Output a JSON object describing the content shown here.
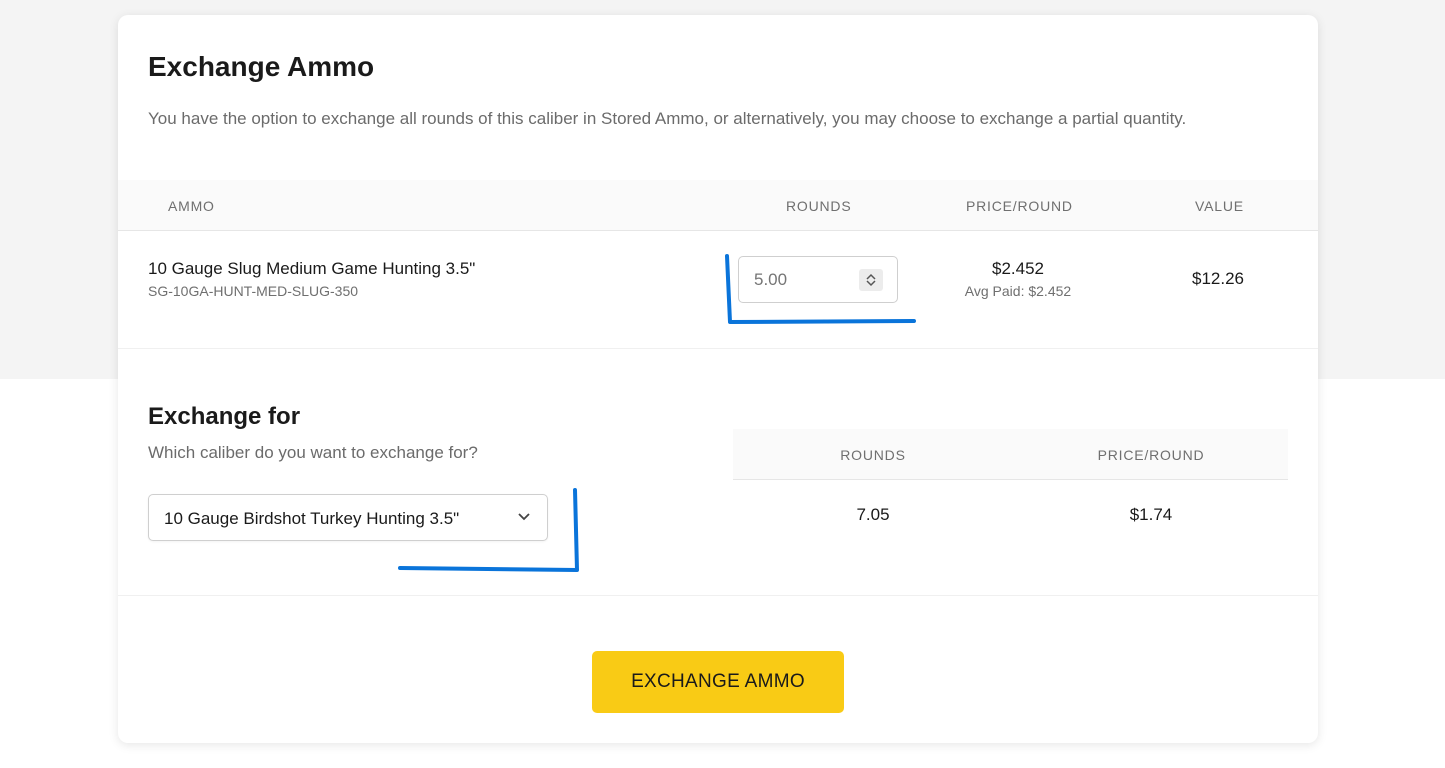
{
  "header": {
    "title": "Exchange Ammo",
    "description": "You have the option to exchange all rounds of this caliber in Stored Ammo, or alternatively, you may choose to exchange a partial quantity."
  },
  "table": {
    "columns": [
      "AMMO",
      "ROUNDS",
      "PRICE/ROUND",
      "VALUE"
    ],
    "row": {
      "name": "10 Gauge Slug Medium Game Hunting 3.5\"",
      "sku": "SG-10GA-HUNT-MED-SLUG-350",
      "rounds_placeholder": "5.00",
      "price": "$2.452",
      "avg_paid": "Avg Paid: $2.452",
      "value": "$12.26"
    }
  },
  "exchange": {
    "title": "Exchange for",
    "subtitle": "Which caliber do you want to exchange for?",
    "selected": "10 Gauge Birdshot Turkey Hunting 3.5\"",
    "columns": [
      "ROUNDS",
      "PRICE/ROUND"
    ],
    "rounds": "7.05",
    "price": "$1.74"
  },
  "actions": {
    "exchange_label": "EXCHANGE AMMO"
  },
  "colors": {
    "accent": "#f9cb15",
    "annotation": "#0a74da"
  }
}
